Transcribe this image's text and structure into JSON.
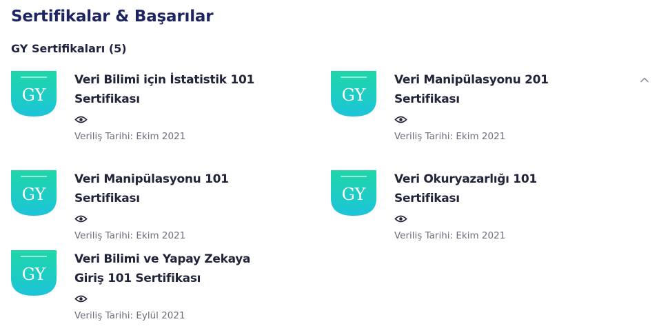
{
  "page": {
    "title": "Sertifikalar & Başarılar",
    "section_heading": "GY Sertifikaları (5)"
  },
  "badge": {
    "text": "GY",
    "gradient_top": "#1fd6a8",
    "gradient_bottom": "#1cc4d9"
  },
  "certificates": [
    {
      "title": "Veri Bilimi için İstatistik 101 Sertifikası",
      "date": "Veriliş Tarihi: Ekim 2021"
    },
    {
      "title": "Veri Manipülasyonu 201 Sertifikası",
      "date": "Veriliş Tarihi: Ekim 2021"
    },
    {
      "title": "Veri Manipülasyonu 101 Sertifikası",
      "date": "Veriliş Tarihi: Ekim 2021"
    },
    {
      "title": "Veri Okuryazarlığı 101 Sertifikası",
      "date": "Veriliş Tarihi: Ekim 2021"
    },
    {
      "title": "Veri Bilimi ve Yapay Zekaya Giriş 101 Sertifikası",
      "date": "Veriliş Tarihi: Eylül 2021"
    }
  ],
  "icons": {
    "view": "eye-icon",
    "collapse": "chevron-up-icon"
  }
}
